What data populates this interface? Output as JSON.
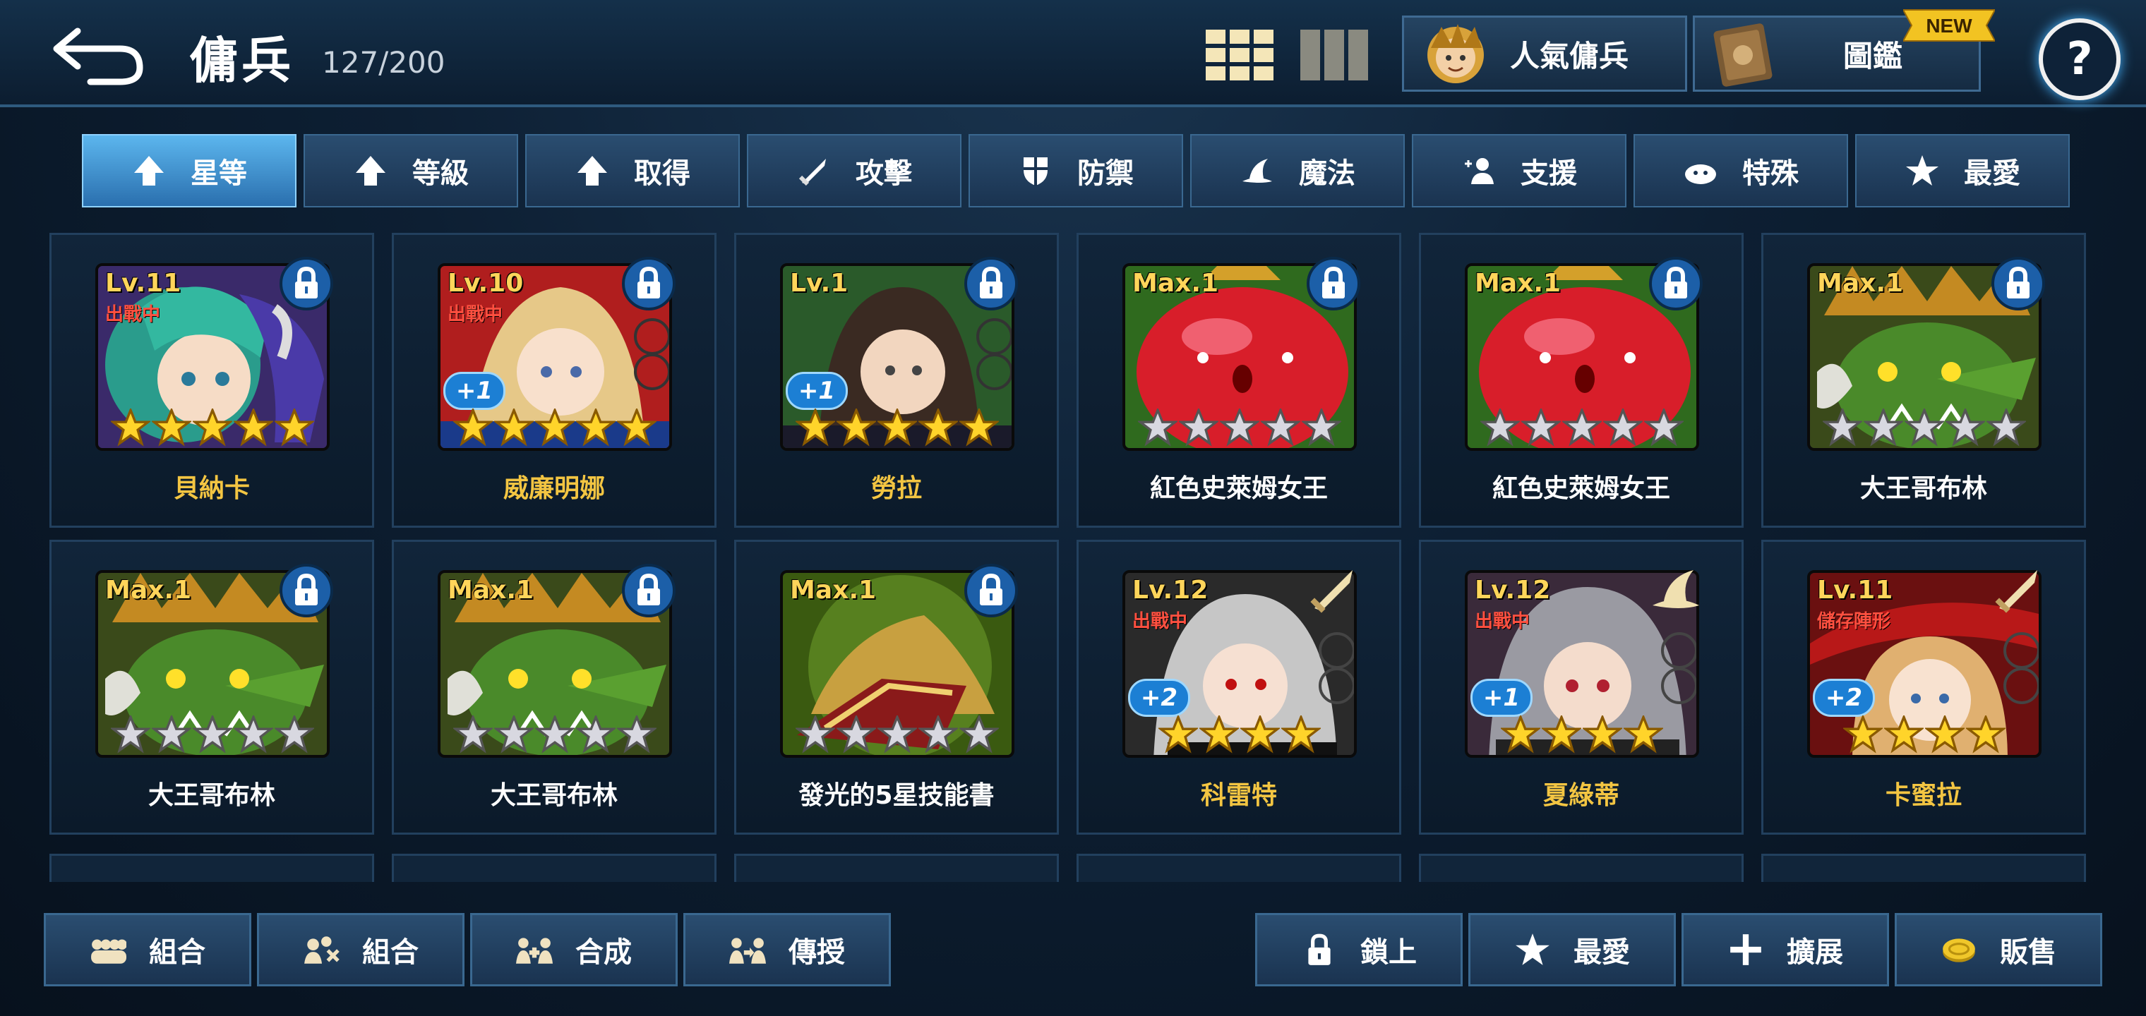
{
  "header": {
    "title": "傭兵",
    "count": "127/200",
    "popular_label": "人氣傭兵",
    "codex_label": "圖鑑",
    "new_badge": "NEW",
    "help": "?"
  },
  "filters": [
    {
      "label": "星等",
      "icon": "arrow-up-icon",
      "active": true
    },
    {
      "label": "等級",
      "icon": "arrow-up-icon",
      "active": false
    },
    {
      "label": "取得",
      "icon": "arrow-up-icon",
      "active": false
    },
    {
      "label": "攻擊",
      "icon": "sword-icon",
      "active": false
    },
    {
      "label": "防禦",
      "icon": "shield-icon",
      "active": false
    },
    {
      "label": "魔法",
      "icon": "witch-hat-icon",
      "active": false
    },
    {
      "label": "支援",
      "icon": "support-icon",
      "active": false
    },
    {
      "label": "特殊",
      "icon": "slime-icon",
      "active": false
    },
    {
      "label": "最愛",
      "icon": "star-icon",
      "active": false
    }
  ],
  "cards": [
    {
      "level": "Lv.11",
      "status": "出戰中",
      "plus": "",
      "stars": 5,
      "star_color": "gold",
      "name": "貝納卡",
      "name_color": "#f3c542",
      "art": "teal-girl",
      "class_icon": ""
    },
    {
      "level": "Lv.10",
      "status": "出戰中",
      "plus": "+1",
      "stars": 5,
      "star_color": "gold",
      "name": "威廉明娜",
      "name_color": "#f3c542",
      "art": "blonde-girl",
      "class_icon": ""
    },
    {
      "level": "Lv.1",
      "status": "",
      "plus": "+1",
      "stars": 5,
      "star_color": "gold",
      "name": "勞拉",
      "name_color": "#f3c542",
      "art": "dark-girl",
      "class_icon": ""
    },
    {
      "level": "Max.1",
      "status": "",
      "plus": "",
      "stars": 5,
      "star_color": "silver",
      "name": "紅色史萊姆女王",
      "name_color": "#ffffff",
      "art": "red-slime",
      "class_icon": ""
    },
    {
      "level": "Max.1",
      "status": "",
      "plus": "",
      "stars": 5,
      "star_color": "silver",
      "name": "紅色史萊姆女王",
      "name_color": "#ffffff",
      "art": "red-slime",
      "class_icon": ""
    },
    {
      "level": "Max.1",
      "status": "",
      "plus": "",
      "stars": 5,
      "star_color": "silver",
      "name": "大王哥布林",
      "name_color": "#ffffff",
      "art": "goblin",
      "class_icon": ""
    },
    {
      "level": "Max.1",
      "status": "",
      "plus": "",
      "stars": 5,
      "star_color": "silver",
      "name": "大王哥布林",
      "name_color": "#ffffff",
      "art": "goblin",
      "class_icon": ""
    },
    {
      "level": "Max.1",
      "status": "",
      "plus": "",
      "stars": 5,
      "star_color": "silver",
      "name": "大王哥布林",
      "name_color": "#ffffff",
      "art": "goblin",
      "class_icon": ""
    },
    {
      "level": "Max.1",
      "status": "",
      "plus": "",
      "stars": 5,
      "star_color": "silver",
      "name": "發光的5星技能書",
      "name_color": "#ffffff",
      "art": "skill-book",
      "class_icon": ""
    },
    {
      "level": "Lv.12",
      "status": "出戰中",
      "plus": "+2",
      "stars": 4,
      "star_color": "gold",
      "name": "科雷特",
      "name_color": "#f3c542",
      "art": "silver-girl",
      "class_icon": "sword"
    },
    {
      "level": "Lv.12",
      "status": "出戰中",
      "plus": "+1",
      "stars": 4,
      "star_color": "gold",
      "name": "夏綠蒂",
      "name_color": "#f3c542",
      "art": "grey-girl",
      "class_icon": "hat"
    },
    {
      "level": "Lv.11",
      "status": "儲存陣形",
      "plus": "+2",
      "stars": 4,
      "star_color": "gold",
      "name": "卡蜜拉",
      "name_color": "#f3c542",
      "art": "red-hat-girl",
      "class_icon": "sword"
    }
  ],
  "bottom_left": [
    {
      "label": "組合",
      "icon": "group-icon"
    },
    {
      "label": "組合",
      "icon": "combine-icon"
    },
    {
      "label": "合成",
      "icon": "synthesis-icon"
    },
    {
      "label": "傳授",
      "icon": "transfer-icon"
    }
  ],
  "bottom_right": [
    {
      "label": "鎖上",
      "icon": "lock-icon"
    },
    {
      "label": "最愛",
      "icon": "star-icon"
    },
    {
      "label": "擴展",
      "icon": "plus-icon"
    },
    {
      "label": "販售",
      "icon": "coin-icon"
    }
  ]
}
